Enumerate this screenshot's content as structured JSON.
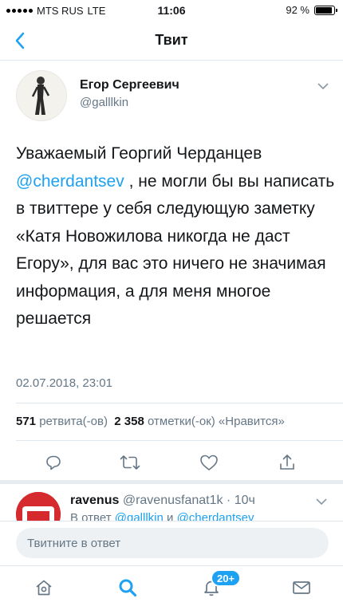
{
  "status_bar": {
    "carrier": "MTS RUS",
    "network": "LTE",
    "time": "11:06",
    "battery": "92 %",
    "battery_level": 0.92
  },
  "nav": {
    "title": "Твит",
    "back_icon": "chevron-left-icon"
  },
  "tweet": {
    "author_name": "Егор Сергеевич",
    "author_handle": "@galllkin",
    "text_part1": "Уважаемый Георгий Черданцев",
    "mention": "@cherdantsev",
    "text_part2": " , не могли бы вы написать в твиттере у себя следующую заметку «Катя Новожилова никогда не даст Егору», для вас это ничего не значимая информация, а для меня многое решается",
    "timestamp": "02.07.2018, 23:01",
    "retweets_count": "571",
    "retweets_label": "ретвита(-ов)",
    "likes_count": "2 358",
    "likes_label": "отметки(-ок) «Нравится»"
  },
  "actions": [
    "reply-icon",
    "retweet-icon",
    "like-icon",
    "share-icon"
  ],
  "reply": {
    "name": "ravenus",
    "handle": "@ravenusfanat1k",
    "separator": " · ",
    "age": "10ч",
    "in_reply_prefix": "В ответ ",
    "mention1": "@galllkin",
    "conj": " и ",
    "mention2": "@cherdantsev"
  },
  "composer": {
    "placeholder": "Твитните в ответ"
  },
  "tabbar": {
    "notifications_badge": "20+"
  },
  "colors": {
    "accent": "#1da1f2",
    "text": "#14171a",
    "secondary": "#657786"
  }
}
